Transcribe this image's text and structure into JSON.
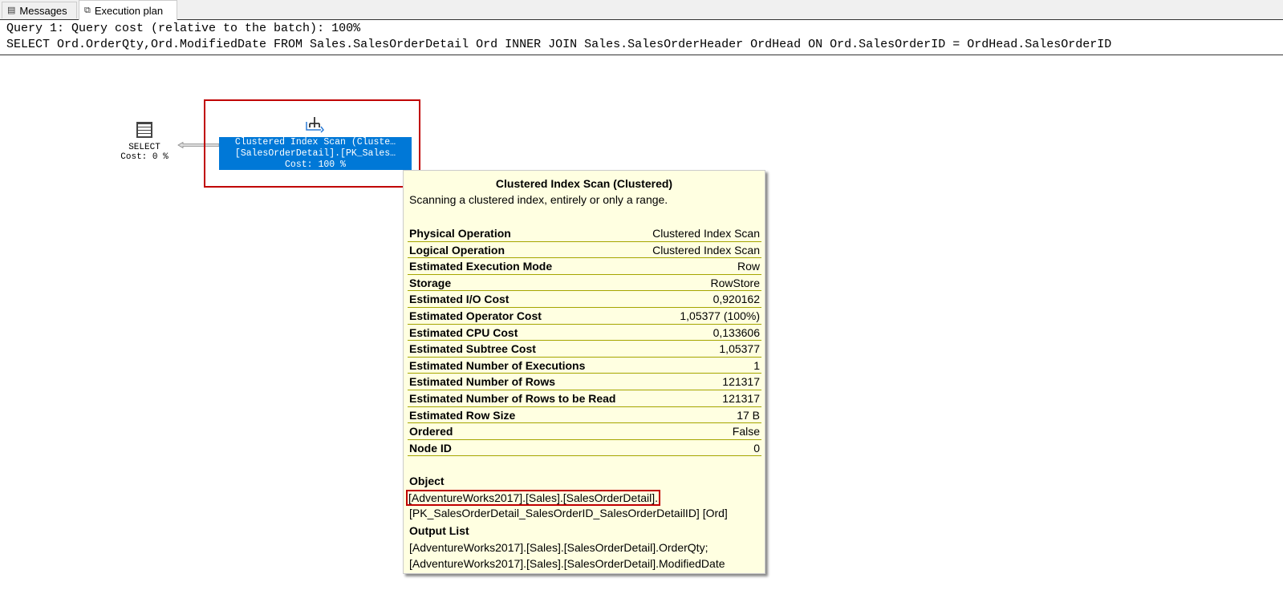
{
  "tabs": [
    {
      "label": "Messages",
      "icon": "messages-icon"
    },
    {
      "label": "Execution plan",
      "icon": "execution-plan-icon"
    }
  ],
  "query": {
    "header": "Query 1: Query cost (relative to the batch): 100%",
    "sql": "SELECT Ord.OrderQty,Ord.ModifiedDate FROM Sales.SalesOrderDetail Ord INNER JOIN Sales.SalesOrderHeader OrdHead ON Ord.SalesOrderID = OrdHead.SalesOrderID"
  },
  "select_node": {
    "label": "SELECT",
    "cost": "Cost: 0 %"
  },
  "scan_node": {
    "line1": "Clustered Index Scan (Cluste…",
    "line2": "[SalesOrderDetail].[PK_Sales…",
    "cost": "Cost: 100 %"
  },
  "tooltip": {
    "title": "Clustered Index Scan (Clustered)",
    "description": "Scanning a clustered index, entirely or only a range.",
    "properties": [
      {
        "k": "Physical Operation",
        "v": "Clustered Index Scan"
      },
      {
        "k": "Logical Operation",
        "v": "Clustered Index Scan"
      },
      {
        "k": "Estimated Execution Mode",
        "v": "Row"
      },
      {
        "k": "Storage",
        "v": "RowStore"
      },
      {
        "k": "Estimated I/O Cost",
        "v": "0,920162"
      },
      {
        "k": "Estimated Operator Cost",
        "v": "1,05377 (100%)"
      },
      {
        "k": "Estimated CPU Cost",
        "v": "0,133606"
      },
      {
        "k": "Estimated Subtree Cost",
        "v": "1,05377"
      },
      {
        "k": "Estimated Number of Executions",
        "v": "1"
      },
      {
        "k": "Estimated Number of Rows",
        "v": "121317"
      },
      {
        "k": "Estimated Number of Rows to be Read",
        "v": "121317"
      },
      {
        "k": "Estimated Row Size",
        "v": "17 B"
      },
      {
        "k": "Ordered",
        "v": "False"
      },
      {
        "k": "Node ID",
        "v": "0"
      }
    ],
    "object_label": "Object",
    "object_line1": "[AdventureWorks2017].[Sales].[SalesOrderDetail].",
    "object_line2": "[PK_SalesOrderDetail_SalesOrderID_SalesOrderDetailID] [Ord]",
    "output_label": "Output List",
    "output_line1": "[AdventureWorks2017].[Sales].[SalesOrderDetail].OrderQty;",
    "output_line2": "[AdventureWorks2017].[Sales].[SalesOrderDetail].ModifiedDate"
  }
}
